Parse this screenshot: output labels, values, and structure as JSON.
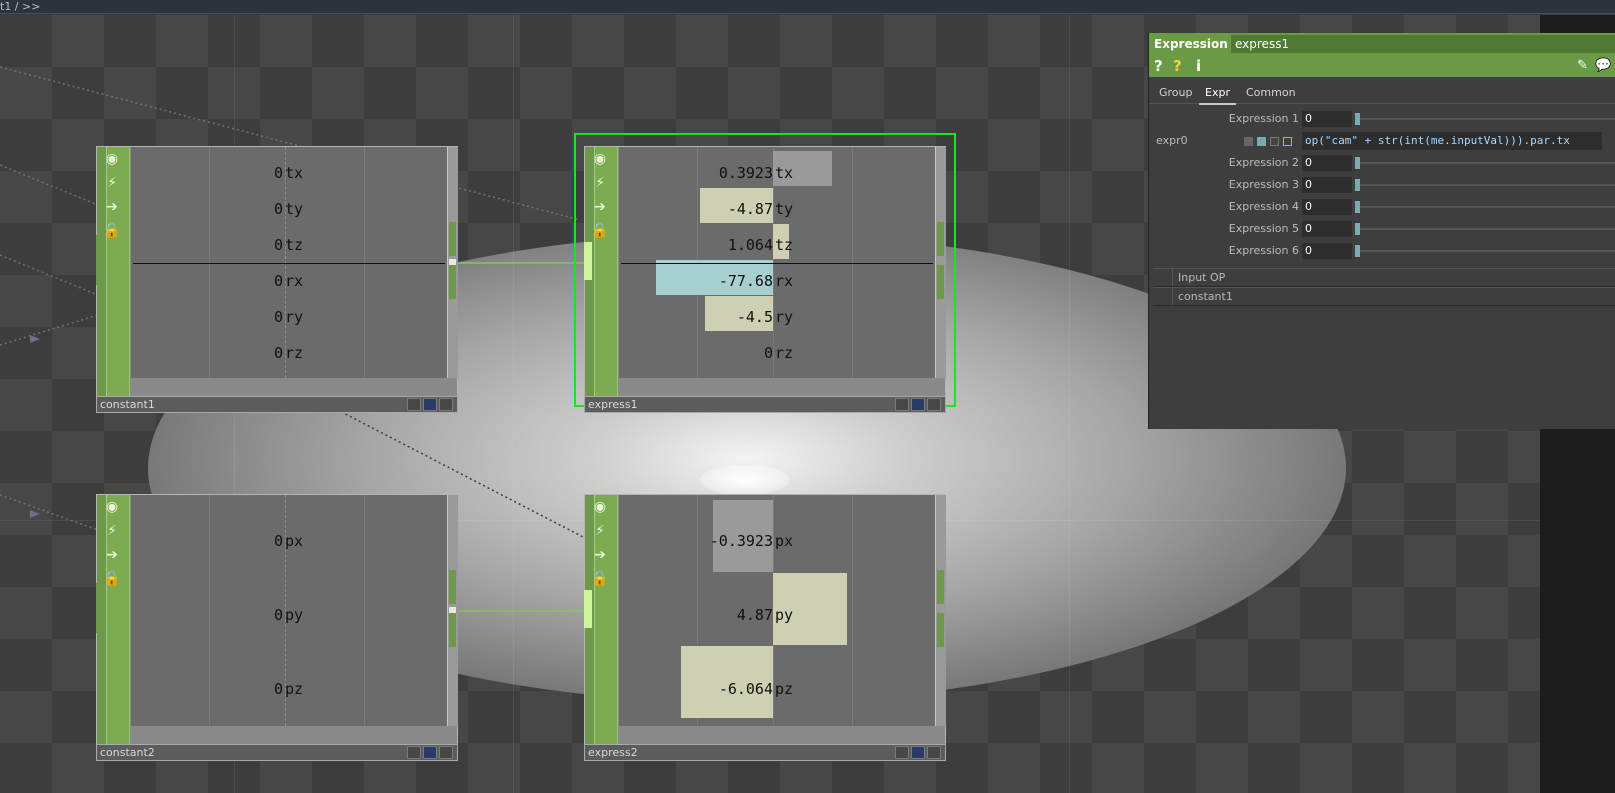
{
  "topbar": {
    "path": "t1 / >>"
  },
  "nodes": {
    "constant1": {
      "name": "constant1",
      "channels": [
        {
          "name": "tx",
          "value": "0"
        },
        {
          "name": "ty",
          "value": "0"
        },
        {
          "name": "tz",
          "value": "0"
        },
        {
          "name": "rx",
          "value": "0"
        },
        {
          "name": "ry",
          "value": "0"
        },
        {
          "name": "rz",
          "value": "0"
        }
      ]
    },
    "express1": {
      "name": "express1",
      "channels": [
        {
          "name": "tx",
          "value": "0.3923"
        },
        {
          "name": "ty",
          "value": "-4.87"
        },
        {
          "name": "tz",
          "value": "1.064"
        },
        {
          "name": "rx",
          "value": "-77.68"
        },
        {
          "name": "ry",
          "value": "-4.5"
        },
        {
          "name": "rz",
          "value": "0"
        }
      ]
    },
    "constant2": {
      "name": "constant2",
      "channels": [
        {
          "name": "px",
          "value": "0"
        },
        {
          "name": "py",
          "value": "0"
        },
        {
          "name": "pz",
          "value": "0"
        }
      ]
    },
    "express2": {
      "name": "express2",
      "channels": [
        {
          "name": "px",
          "value": "-0.3923"
        },
        {
          "name": "py",
          "value": "4.87"
        },
        {
          "name": "pz",
          "value": "-6.064"
        }
      ]
    }
  },
  "panel": {
    "type_label": "Expression",
    "op_name": "express1",
    "icons": {
      "help": "?",
      "python_help": "?",
      "info": "i"
    },
    "tabs": [
      "Group",
      "Expr",
      "Common"
    ],
    "active_tab": "Expr",
    "params": [
      {
        "label": "Expression 1",
        "value": "0"
      },
      {
        "label": "Expression 2",
        "value": "0"
      },
      {
        "label": "Expression 3",
        "value": "0"
      },
      {
        "label": "Expression 4",
        "value": "0"
      },
      {
        "label": "Expression 5",
        "value": "0"
      },
      {
        "label": "Expression 6",
        "value": "0"
      }
    ],
    "expr_row": {
      "label": "expr0",
      "code": "op(\"cam\" + str(int(me.inputVal))).par.tx"
    },
    "inputs": {
      "header": "Input OP",
      "items": [
        "constant1"
      ]
    }
  },
  "colors": {
    "op_green": "#6c9a4a",
    "selection": "#22e022",
    "bar_cream": "#cfcfb4",
    "bar_gray": "#9a9a9a",
    "bar_cyan": "#a6d0d0"
  }
}
